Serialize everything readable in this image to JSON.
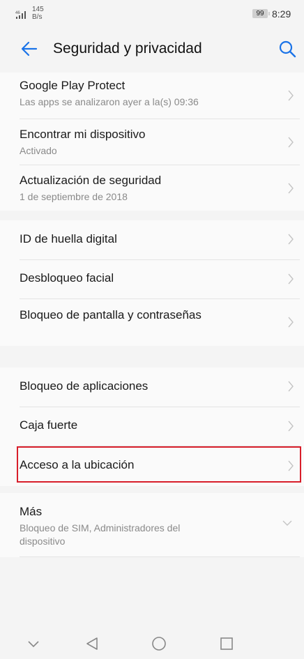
{
  "status_bar": {
    "signal_label": "46",
    "net_speed_value": "145",
    "net_speed_unit": "B/s",
    "battery": "99",
    "time": "8:29"
  },
  "header": {
    "title": "Seguridad y privacidad",
    "back_icon": "arrow-left-icon",
    "search_icon": "search-icon",
    "accent_color": "#1a73e8"
  },
  "sections": [
    {
      "items": [
        {
          "label": "Google Play Protect",
          "sub": "Las apps se analizaron ayer a la(s) 09:36"
        },
        {
          "label": "Encontrar mi dispositivo",
          "sub": "Activado"
        },
        {
          "label": "Actualización de seguridad",
          "sub": "1 de septiembre de 2018"
        }
      ]
    },
    {
      "items": [
        {
          "label": "ID de huella digital"
        },
        {
          "label": "Desbloqueo facial"
        },
        {
          "label": "Bloqueo de pantalla y contraseñas"
        }
      ]
    },
    {
      "items": [
        {
          "label": "Bloqueo de aplicaciones"
        },
        {
          "label": "Caja fuerte"
        },
        {
          "label": "Acceso a la ubicación",
          "highlighted": true
        }
      ]
    },
    {
      "items": [
        {
          "label": "Más",
          "sub": "Bloqueo de SIM, Administradores del dispositivo",
          "expand": true
        }
      ]
    }
  ],
  "highlight_color": "#d81e2a",
  "nav_bar": [
    "chevron-down-icon",
    "back-triangle-icon",
    "home-circle-icon",
    "recents-square-icon"
  ]
}
